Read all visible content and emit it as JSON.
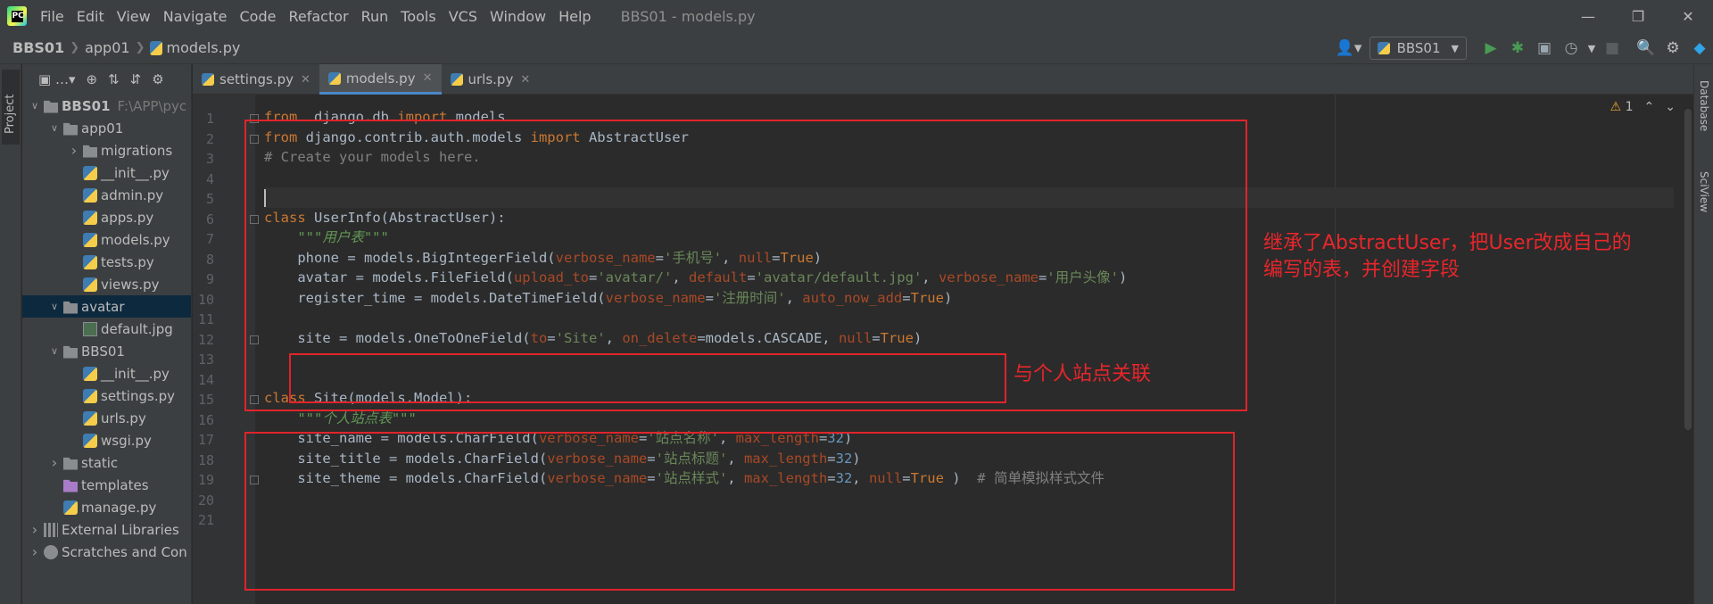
{
  "app": {
    "logo_text": "PC",
    "menu": [
      "File",
      "Edit",
      "View",
      "Navigate",
      "Code",
      "Refactor",
      "Run",
      "Tools",
      "VCS",
      "Window",
      "Help"
    ],
    "window_title": "BBS01 - models.py",
    "window_controls": [
      "minimize-icon",
      "restore-icon",
      "close-icon"
    ]
  },
  "navbar": {
    "breadcrumb": [
      "BBS01",
      "app01",
      "models.py"
    ],
    "run_config": "BBS01",
    "toolbar_icons": [
      "user-icon",
      "run-icon",
      "debug-icon",
      "coverage-icon",
      "profile-icon",
      "stop-icon",
      "search-icon",
      "settings-icon",
      "jetbrains-toolbox-icon"
    ]
  },
  "left_strip": {
    "tab_label": "Project"
  },
  "right_strip": {
    "tabs": [
      "Database",
      "SciView"
    ]
  },
  "project_tree": [
    {
      "label": "BBS01",
      "path": "F:\\APP\\pyc",
      "type": "folder",
      "depth": 0,
      "expanded": true,
      "bold": true
    },
    {
      "label": "app01",
      "type": "folder",
      "depth": 1,
      "expanded": true
    },
    {
      "label": "migrations",
      "type": "folder",
      "depth": 2,
      "expanded": false
    },
    {
      "label": "__init__.py",
      "type": "py",
      "depth": 2
    },
    {
      "label": "admin.py",
      "type": "py",
      "depth": 2
    },
    {
      "label": "apps.py",
      "type": "py",
      "depth": 2
    },
    {
      "label": "models.py",
      "type": "py",
      "depth": 2
    },
    {
      "label": "tests.py",
      "type": "py",
      "depth": 2
    },
    {
      "label": "views.py",
      "type": "py",
      "depth": 2
    },
    {
      "label": "avatar",
      "type": "folder",
      "depth": 1,
      "expanded": true,
      "selected": true
    },
    {
      "label": "default.jpg",
      "type": "img",
      "depth": 2
    },
    {
      "label": "BBS01",
      "type": "folder",
      "depth": 1,
      "expanded": true
    },
    {
      "label": "__init__.py",
      "type": "py",
      "depth": 2
    },
    {
      "label": "settings.py",
      "type": "py",
      "depth": 2
    },
    {
      "label": "urls.py",
      "type": "py",
      "depth": 2
    },
    {
      "label": "wsgi.py",
      "type": "py",
      "depth": 2
    },
    {
      "label": "static",
      "type": "folder",
      "depth": 1,
      "expanded": false
    },
    {
      "label": "templates",
      "type": "folder-purple",
      "depth": 1
    },
    {
      "label": "manage.py",
      "type": "py",
      "depth": 1
    },
    {
      "label": "External Libraries",
      "type": "lib",
      "depth": 0,
      "expanded": false
    },
    {
      "label": "Scratches and Con",
      "type": "scratch",
      "depth": 0,
      "expanded": false
    }
  ],
  "editor": {
    "tabs": [
      {
        "label": "settings.py",
        "active": false
      },
      {
        "label": "models.py",
        "active": true
      },
      {
        "label": "urls.py",
        "active": false
      }
    ],
    "inspection": {
      "warnings": "1"
    },
    "current_line": 5,
    "lines": [
      {
        "n": "1",
        "fold": true,
        "tokens": [
          [
            "kw",
            "from"
          ],
          [
            "",
            "  django.db "
          ],
          [
            "kw",
            "import"
          ],
          [
            "",
            " models"
          ]
        ]
      },
      {
        "n": "2",
        "fold": true,
        "tokens": [
          [
            "kw",
            "from"
          ],
          [
            "",
            " django.contrib.auth.models "
          ],
          [
            "kw",
            "import"
          ],
          [
            "",
            " AbstractUser"
          ]
        ]
      },
      {
        "n": "3",
        "tokens": [
          [
            "cmt",
            "# Create your models here."
          ]
        ]
      },
      {
        "n": "4",
        "tokens": []
      },
      {
        "n": "5",
        "tokens": []
      },
      {
        "n": "6",
        "fold": true,
        "tokens": [
          [
            "kw",
            "class"
          ],
          [
            "",
            " UserInfo(AbstractUser):"
          ]
        ]
      },
      {
        "n": "7",
        "tokens": [
          [
            "",
            "    "
          ],
          [
            "doc",
            "\"\"\"用户表\"\"\""
          ]
        ]
      },
      {
        "n": "8",
        "tokens": [
          [
            "",
            "    phone = models.BigIntegerField("
          ],
          [
            "param",
            "verbose_name"
          ],
          [
            "",
            "="
          ],
          [
            "str",
            "'手机号'"
          ],
          [
            "",
            ", "
          ],
          [
            "param",
            "null"
          ],
          [
            "",
            "="
          ],
          [
            "kw",
            "True"
          ],
          [
            "",
            ")"
          ]
        ]
      },
      {
        "n": "9",
        "tokens": [
          [
            "",
            "    avatar = models.FileField("
          ],
          [
            "param",
            "upload_to"
          ],
          [
            "",
            "="
          ],
          [
            "str",
            "'avatar/'"
          ],
          [
            "",
            ", "
          ],
          [
            "param",
            "default"
          ],
          [
            "",
            "="
          ],
          [
            "str",
            "'avatar/default.jpg'"
          ],
          [
            "",
            ", "
          ],
          [
            "param",
            "verbose_name"
          ],
          [
            "",
            "="
          ],
          [
            "str",
            "'用户头像'"
          ],
          [
            "",
            ")"
          ]
        ]
      },
      {
        "n": "10",
        "tokens": [
          [
            "",
            "    register_time = models.DateTimeField("
          ],
          [
            "param",
            "verbose_name"
          ],
          [
            "",
            "="
          ],
          [
            "str",
            "'注册时间'"
          ],
          [
            "",
            ", "
          ],
          [
            "param",
            "auto_now_add"
          ],
          [
            "",
            "="
          ],
          [
            "kw",
            "True"
          ],
          [
            "",
            ")"
          ]
        ]
      },
      {
        "n": "11",
        "tokens": []
      },
      {
        "n": "12",
        "fold": true,
        "tokens": [
          [
            "",
            "    site = models.OneToOneField("
          ],
          [
            "param",
            "to"
          ],
          [
            "",
            "="
          ],
          [
            "str",
            "'Site'"
          ],
          [
            "",
            ", "
          ],
          [
            "param",
            "on_delete"
          ],
          [
            "",
            "=models.CASCADE, "
          ],
          [
            "param",
            "null"
          ],
          [
            "",
            "="
          ],
          [
            "kw",
            "True"
          ],
          [
            "",
            ")"
          ]
        ]
      },
      {
        "n": "13",
        "tokens": []
      },
      {
        "n": "14",
        "tokens": []
      },
      {
        "n": "15",
        "fold": true,
        "tokens": [
          [
            "kw",
            "class"
          ],
          [
            "",
            " Site(models.Model):"
          ]
        ]
      },
      {
        "n": "16",
        "tokens": [
          [
            "",
            "    "
          ],
          [
            "doc",
            "\"\"\"个人站点表\"\"\""
          ]
        ]
      },
      {
        "n": "17",
        "tokens": [
          [
            "",
            "    site_name = models.CharField("
          ],
          [
            "param",
            "verbose_name"
          ],
          [
            "",
            "="
          ],
          [
            "str",
            "'站点名称'"
          ],
          [
            "",
            ", "
          ],
          [
            "param",
            "max_length"
          ],
          [
            "",
            "="
          ],
          [
            "num",
            "32"
          ],
          [
            "",
            ")"
          ]
        ]
      },
      {
        "n": "18",
        "tokens": [
          [
            "",
            "    site_title = models.CharField("
          ],
          [
            "param",
            "verbose_name"
          ],
          [
            "",
            "="
          ],
          [
            "str",
            "'站点标题'"
          ],
          [
            "",
            ", "
          ],
          [
            "param",
            "max_length"
          ],
          [
            "",
            "="
          ],
          [
            "num",
            "32"
          ],
          [
            "",
            ")"
          ]
        ]
      },
      {
        "n": "19",
        "fold": true,
        "tokens": [
          [
            "",
            "    site_theme = models.CharField("
          ],
          [
            "param",
            "verbose_name"
          ],
          [
            "",
            "="
          ],
          [
            "str",
            "'站点样式'"
          ],
          [
            "",
            ", "
          ],
          [
            "param",
            "max_length"
          ],
          [
            "",
            "="
          ],
          [
            "num",
            "32"
          ],
          [
            "",
            ", "
          ],
          [
            "param",
            "null"
          ],
          [
            "",
            "="
          ],
          [
            "kw",
            "True"
          ],
          [
            "",
            " )  "
          ],
          [
            "cmt",
            "# 简单模拟样式文件"
          ]
        ]
      },
      {
        "n": "20",
        "tokens": []
      },
      {
        "n": "21",
        "tokens": []
      }
    ]
  },
  "annotations": {
    "userinfo_note_line1": "继承了AbstractUser，把User改成自己的",
    "userinfo_note_line2": "编写的表，并创建字段",
    "site_field_note": "与个人站点关联",
    "color": "#e0242a"
  }
}
